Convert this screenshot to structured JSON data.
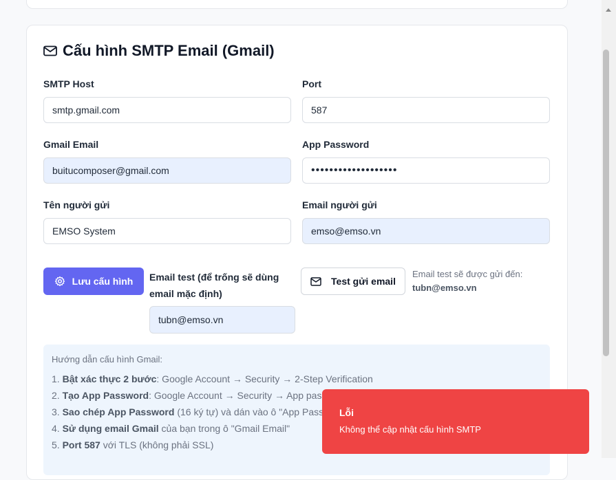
{
  "smtp": {
    "title": "Cấu hình SMTP Email (Gmail)",
    "host_label": "SMTP Host",
    "host_value": "smtp.gmail.com",
    "port_label": "Port",
    "port_value": "587",
    "gmail_label": "Gmail Email",
    "gmail_value": "buitucomposer@gmail.com",
    "app_password_label": "App Password",
    "app_password_value": "•••••••••••••••••••",
    "sender_name_label": "Tên người gửi",
    "sender_name_value": "EMSO System",
    "sender_email_label": "Email người gửi",
    "sender_email_value": "emso@emso.vn"
  },
  "actions": {
    "save_label": "Lưu cấu hình",
    "test_email_label": "Email test (để trống sẽ dùng email mặc định)",
    "test_email_value": "tubn@emso.vn",
    "test_button_label": "Test gửi email",
    "note_prefix": "Email test sẽ được gửi đến:",
    "note_email": "tubn@emso.vn"
  },
  "guide": {
    "title": "Hướng dẫn cấu hình Gmail:",
    "steps": [
      {
        "num": "1.",
        "bold": "Bật xác thực 2 bước",
        "rest": ": Google Account → Security → 2-Step Verification"
      },
      {
        "num": "2.",
        "bold": "Tạo App Password",
        "rest": ": Google Account → Security → App passwords"
      },
      {
        "num": "3.",
        "bold": "Sao chép App Password",
        "rest": " (16 ký tự) và dán vào ô \"App Password\""
      },
      {
        "num": "4.",
        "bold": "Sử dụng email Gmail",
        "rest": " của bạn trong ô \"Gmail Email\""
      },
      {
        "num": "5.",
        "bold": "Port 587",
        "rest": " với TLS (không phải SSL)"
      }
    ]
  },
  "toast": {
    "title": "Lỗi",
    "message": "Không thể cập nhật cấu hình SMTP"
  },
  "colors": {
    "primary": "#6366f1",
    "error": "#ef4444",
    "autofill": "#e8f0fe",
    "guide_bg": "#eef5fd"
  }
}
